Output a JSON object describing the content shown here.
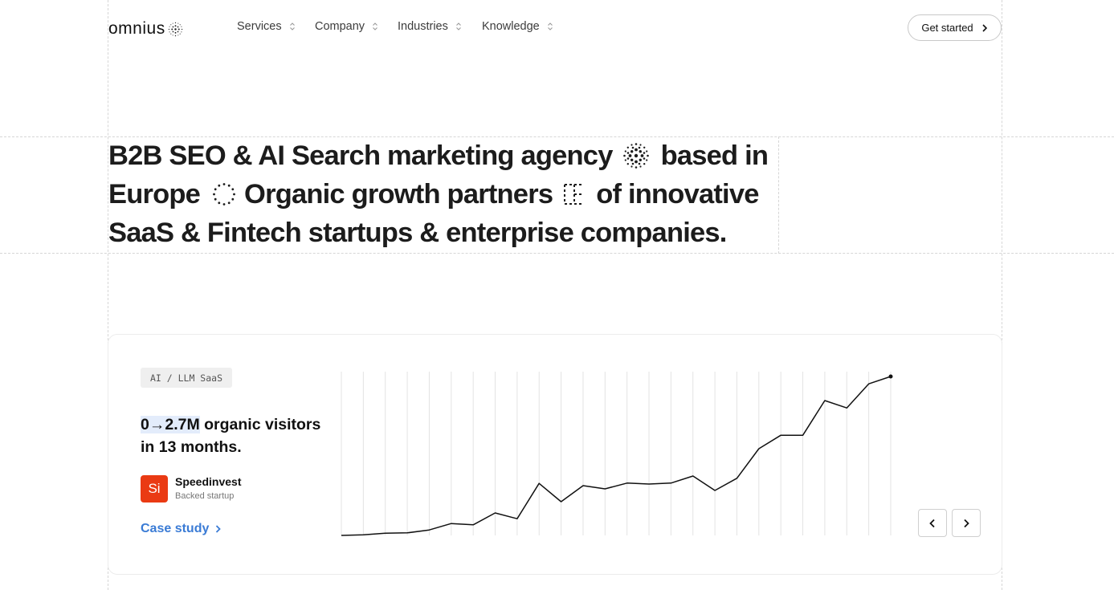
{
  "header": {
    "logo_text": "omnius",
    "nav": [
      {
        "label": "Services"
      },
      {
        "label": "Company"
      },
      {
        "label": "Industries"
      },
      {
        "label": "Knowledge"
      }
    ],
    "cta_label": "Get started"
  },
  "hero": {
    "line1_a": "B2B SEO & AI Search marketing agency",
    "line1_b": "based in",
    "line2_a": "Europe",
    "line2_b": "Organic growth partners",
    "line2_c": "of innovative",
    "line3": "SaaS & Fintech startups & enterprise companies."
  },
  "case": {
    "tag": "AI / LLM SaaS",
    "headline_highlight": "0→2.7M",
    "headline_rest": " organic visitors in 13 months.",
    "company_logo_text": "Si",
    "company_name": "Speedinvest",
    "company_sub": "Backed startup",
    "link_label": "Case study",
    "colors": {
      "accent": "#3a7bd5",
      "company_logo": "#ea3a13",
      "highlight": "#e3ecfb"
    }
  },
  "chart_data": {
    "type": "line",
    "title": "",
    "xlabel": "",
    "ylabel": "",
    "grid": "vertical",
    "values": [
      0.0,
      0.02,
      0.07,
      0.08,
      0.17,
      0.37,
      0.33,
      0.7,
      0.52,
      1.62,
      1.05,
      1.55,
      1.45,
      1.63,
      1.6,
      1.63,
      1.85,
      1.4,
      1.78,
      2.7,
      3.12,
      3.12,
      4.2,
      3.97,
      4.72,
      4.95
    ],
    "ylim": [
      0,
      4.95
    ]
  }
}
